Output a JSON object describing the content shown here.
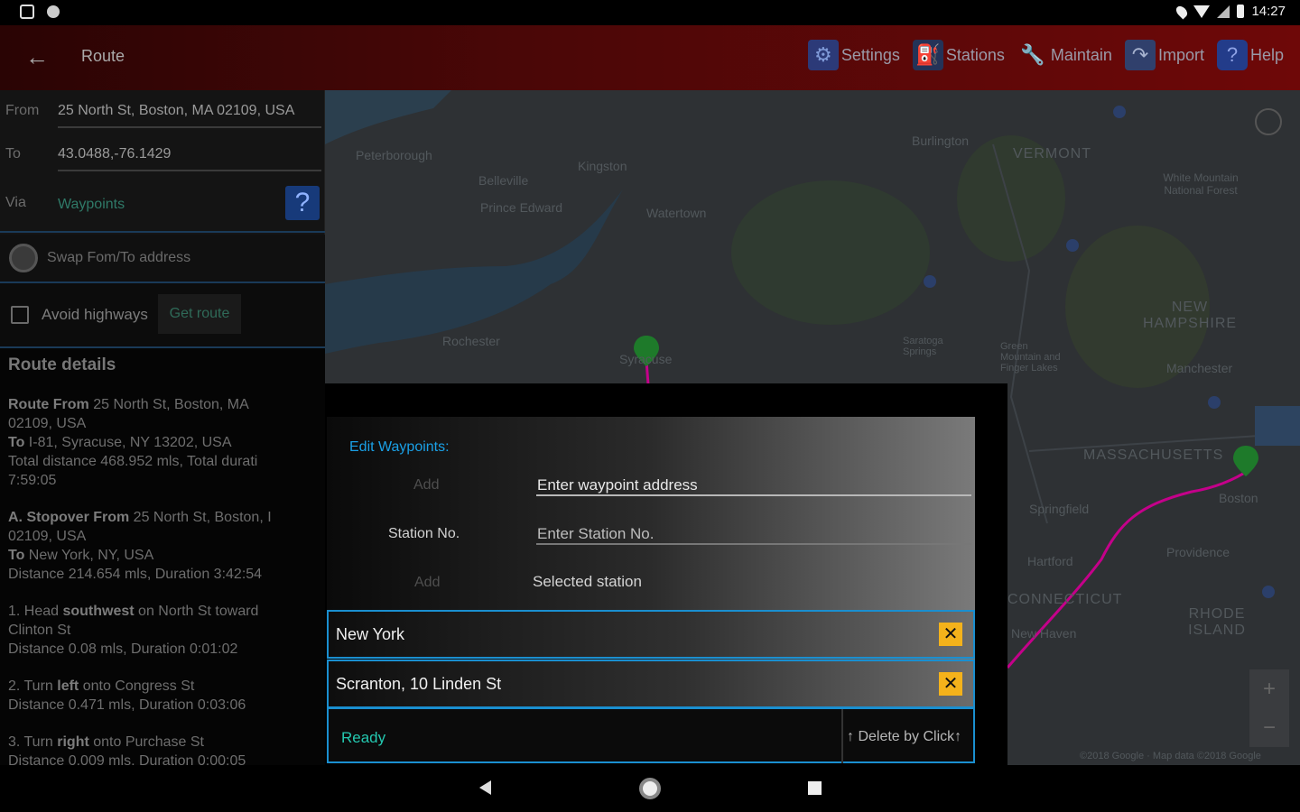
{
  "status_bar": {
    "time": "14:27"
  },
  "app_bar": {
    "title": "Route",
    "actions": [
      {
        "label": "Settings",
        "icon": "gear-icon"
      },
      {
        "label": "Stations",
        "icon": "station-icon"
      },
      {
        "label": "Maintain",
        "icon": "wrench-icon"
      },
      {
        "label": "Import",
        "icon": "import-icon"
      },
      {
        "label": "Help",
        "icon": "help-icon"
      }
    ]
  },
  "route_form": {
    "from_label": "From",
    "from_value": "25 North St, Boston, MA 02109, USA",
    "to_label": "To",
    "to_value": "43.0488,-76.1429",
    "via_label": "Via",
    "via_link": "Waypoints",
    "swap_label": "Swap Fom/To address",
    "avoid_label": "Avoid highways",
    "get_route_label": "Get route"
  },
  "route_details": {
    "title": "Route details",
    "blocks": [
      {
        "bold": "Route From",
        "text": " 25 North St, Boston, MA\n02109, USA\n",
        "bold2": "To",
        "text2": " I-81, Syracuse, NY 13202, USA\nTotal distance 468.952 mls, Total durati\n7:59:05"
      },
      {
        "bold": "A. Stopover From",
        "text": " 25 North St, Boston, I\n02109, USA\n",
        "bold2": "To",
        "text2": " New York, NY, USA\nDistance 214.654 mls, Duration 3:42:54"
      },
      {
        "bold": "",
        "text": "1. Head ",
        "bold2": "southwest",
        "text2": " on North St toward\nClinton St\nDistance 0.08 mls, Duration 0:01:02"
      },
      {
        "bold": "",
        "text": "2. Turn ",
        "bold2": "left",
        "text2": " onto Congress St\nDistance 0.471 mls, Duration 0:03:06"
      },
      {
        "bold": "",
        "text": "3. Turn ",
        "bold2": "right",
        "text2": " onto Purchase St\nDistance 0.009 mls, Duration 0:00:05"
      }
    ]
  },
  "map": {
    "labels": [
      "Peterborough",
      "Kingston",
      "Belleville",
      "Prince Edward",
      "Watertown",
      "Rochester",
      "Syracuse",
      "Burlington",
      "VERMONT",
      "White Mountain National Forest",
      "NEW HAMPSHIRE",
      "Manchester",
      "MASSACHUSETTS",
      "Boston",
      "Springfield",
      "Hartford",
      "Providence",
      "CONNECTICUT",
      "RHODE ISLAND",
      "New Haven",
      "Saratoga Springs",
      "Green Mountain and Finger Lakes",
      "©2018 Google · Map data ©2018 Google"
    ],
    "route_color": "#c4008a",
    "marker_color": "#1e7a2a"
  },
  "waypoint_dialog": {
    "title": "Edit Waypoints:",
    "add_label": "Add",
    "address_placeholder": "Enter waypoint address",
    "station_label": "Station No.",
    "station_placeholder": "Enter Station No.",
    "add_label2": "Add",
    "selected_station": "Selected station",
    "waypoints": [
      "New York",
      "Scranton, 10 Linden St"
    ],
    "status": "Ready",
    "hint": "↑ Delete by Click↑"
  }
}
